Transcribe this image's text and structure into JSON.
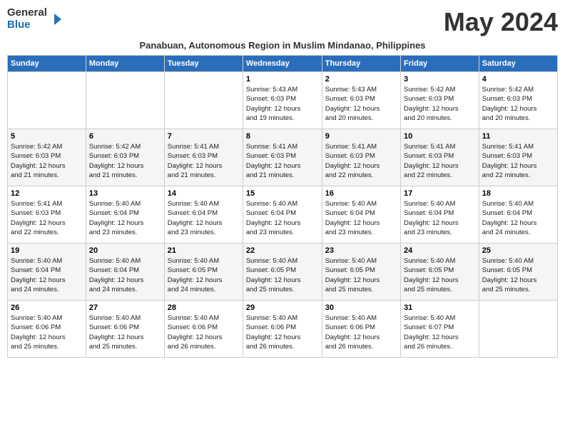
{
  "logo": {
    "general": "General",
    "blue": "Blue"
  },
  "title": "May 2024",
  "subtitle": "Panabuan, Autonomous Region in Muslim Mindanao, Philippines",
  "days_of_week": [
    "Sunday",
    "Monday",
    "Tuesday",
    "Wednesday",
    "Thursday",
    "Friday",
    "Saturday"
  ],
  "weeks": [
    [
      {
        "day": "",
        "info": ""
      },
      {
        "day": "",
        "info": ""
      },
      {
        "day": "",
        "info": ""
      },
      {
        "day": "1",
        "info": "Sunrise: 5:43 AM\nSunset: 6:03 PM\nDaylight: 12 hours\nand 19 minutes."
      },
      {
        "day": "2",
        "info": "Sunrise: 5:43 AM\nSunset: 6:03 PM\nDaylight: 12 hours\nand 20 minutes."
      },
      {
        "day": "3",
        "info": "Sunrise: 5:42 AM\nSunset: 6:03 PM\nDaylight: 12 hours\nand 20 minutes."
      },
      {
        "day": "4",
        "info": "Sunrise: 5:42 AM\nSunset: 6:03 PM\nDaylight: 12 hours\nand 20 minutes."
      }
    ],
    [
      {
        "day": "5",
        "info": "Sunrise: 5:42 AM\nSunset: 6:03 PM\nDaylight: 12 hours\nand 21 minutes."
      },
      {
        "day": "6",
        "info": "Sunrise: 5:42 AM\nSunset: 6:03 PM\nDaylight: 12 hours\nand 21 minutes."
      },
      {
        "day": "7",
        "info": "Sunrise: 5:41 AM\nSunset: 6:03 PM\nDaylight: 12 hours\nand 21 minutes."
      },
      {
        "day": "8",
        "info": "Sunrise: 5:41 AM\nSunset: 6:03 PM\nDaylight: 12 hours\nand 21 minutes."
      },
      {
        "day": "9",
        "info": "Sunrise: 5:41 AM\nSunset: 6:03 PM\nDaylight: 12 hours\nand 22 minutes."
      },
      {
        "day": "10",
        "info": "Sunrise: 5:41 AM\nSunset: 6:03 PM\nDaylight: 12 hours\nand 22 minutes."
      },
      {
        "day": "11",
        "info": "Sunrise: 5:41 AM\nSunset: 6:03 PM\nDaylight: 12 hours\nand 22 minutes."
      }
    ],
    [
      {
        "day": "12",
        "info": "Sunrise: 5:41 AM\nSunset: 6:03 PM\nDaylight: 12 hours\nand 22 minutes."
      },
      {
        "day": "13",
        "info": "Sunrise: 5:40 AM\nSunset: 6:04 PM\nDaylight: 12 hours\nand 23 minutes."
      },
      {
        "day": "14",
        "info": "Sunrise: 5:40 AM\nSunset: 6:04 PM\nDaylight: 12 hours\nand 23 minutes."
      },
      {
        "day": "15",
        "info": "Sunrise: 5:40 AM\nSunset: 6:04 PM\nDaylight: 12 hours\nand 23 minutes."
      },
      {
        "day": "16",
        "info": "Sunrise: 5:40 AM\nSunset: 6:04 PM\nDaylight: 12 hours\nand 23 minutes."
      },
      {
        "day": "17",
        "info": "Sunrise: 5:40 AM\nSunset: 6:04 PM\nDaylight: 12 hours\nand 23 minutes."
      },
      {
        "day": "18",
        "info": "Sunrise: 5:40 AM\nSunset: 6:04 PM\nDaylight: 12 hours\nand 24 minutes."
      }
    ],
    [
      {
        "day": "19",
        "info": "Sunrise: 5:40 AM\nSunset: 6:04 PM\nDaylight: 12 hours\nand 24 minutes."
      },
      {
        "day": "20",
        "info": "Sunrise: 5:40 AM\nSunset: 6:04 PM\nDaylight: 12 hours\nand 24 minutes."
      },
      {
        "day": "21",
        "info": "Sunrise: 5:40 AM\nSunset: 6:05 PM\nDaylight: 12 hours\nand 24 minutes."
      },
      {
        "day": "22",
        "info": "Sunrise: 5:40 AM\nSunset: 6:05 PM\nDaylight: 12 hours\nand 25 minutes."
      },
      {
        "day": "23",
        "info": "Sunrise: 5:40 AM\nSunset: 6:05 PM\nDaylight: 12 hours\nand 25 minutes."
      },
      {
        "day": "24",
        "info": "Sunrise: 5:40 AM\nSunset: 6:05 PM\nDaylight: 12 hours\nand 25 minutes."
      },
      {
        "day": "25",
        "info": "Sunrise: 5:40 AM\nSunset: 6:05 PM\nDaylight: 12 hours\nand 25 minutes."
      }
    ],
    [
      {
        "day": "26",
        "info": "Sunrise: 5:40 AM\nSunset: 6:06 PM\nDaylight: 12 hours\nand 25 minutes."
      },
      {
        "day": "27",
        "info": "Sunrise: 5:40 AM\nSunset: 6:06 PM\nDaylight: 12 hours\nand 25 minutes."
      },
      {
        "day": "28",
        "info": "Sunrise: 5:40 AM\nSunset: 6:06 PM\nDaylight: 12 hours\nand 26 minutes."
      },
      {
        "day": "29",
        "info": "Sunrise: 5:40 AM\nSunset: 6:06 PM\nDaylight: 12 hours\nand 26 minutes."
      },
      {
        "day": "30",
        "info": "Sunrise: 5:40 AM\nSunset: 6:06 PM\nDaylight: 12 hours\nand 26 minutes."
      },
      {
        "day": "31",
        "info": "Sunrise: 5:40 AM\nSunset: 6:07 PM\nDaylight: 12 hours\nand 26 minutes."
      },
      {
        "day": "",
        "info": ""
      }
    ]
  ]
}
